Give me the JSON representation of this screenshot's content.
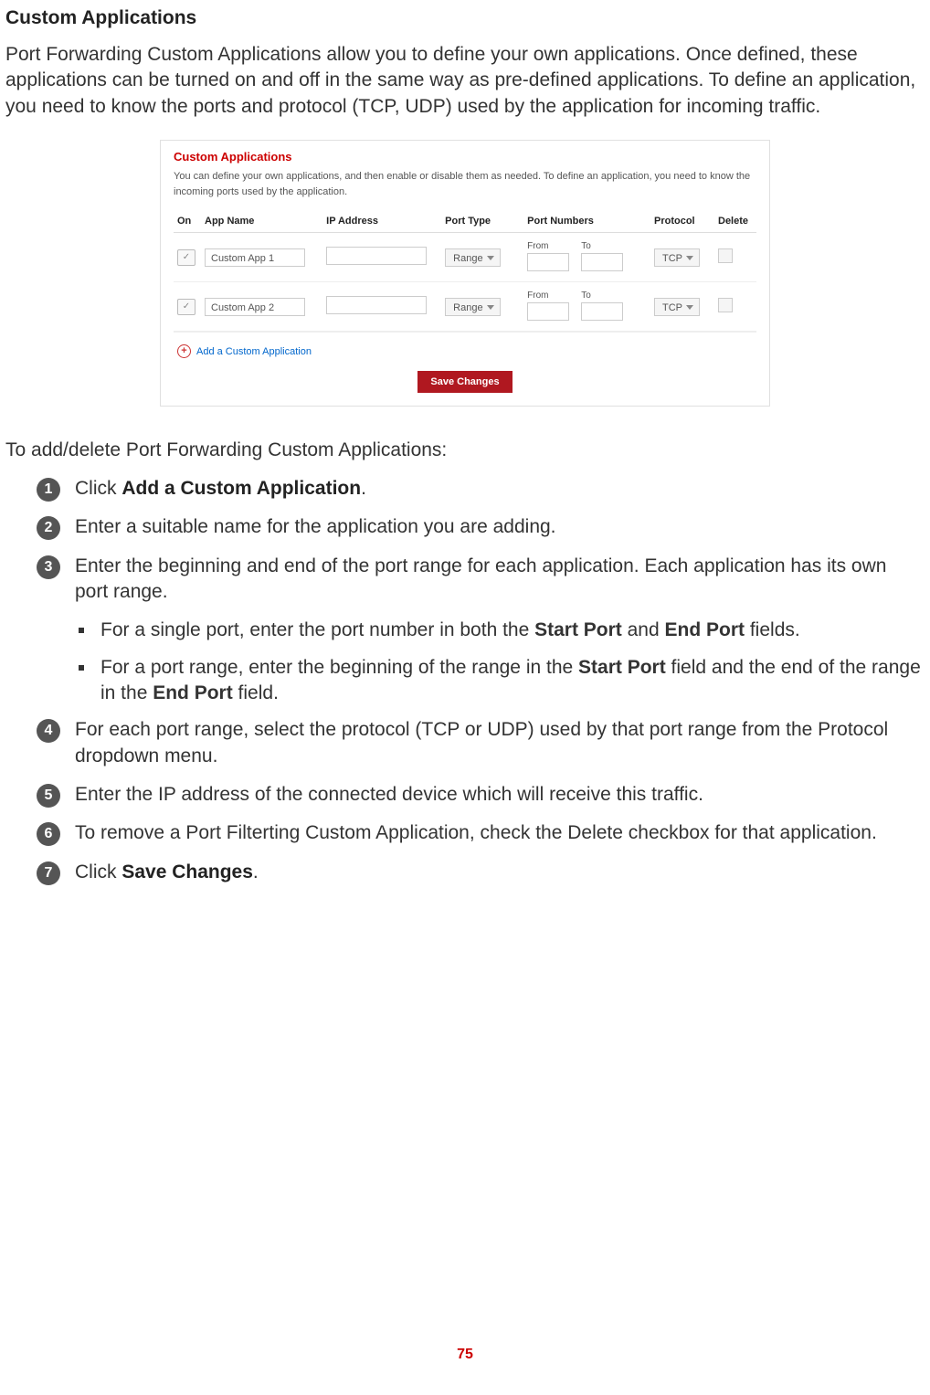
{
  "title": "Custom Applications",
  "intro": "Port Forwarding Custom Applications allow you to define your own applications. Once defined, these applications can be turned on and off in the same way as pre-defined applications. To define an application, you need to know the ports and protocol (TCP, UDP) used by the application for incoming traffic.",
  "panel": {
    "title": "Custom Applications",
    "desc": "You can define your own applications, and then enable or disable them as needed. To define an application, you need to know the incoming ports used by the application.",
    "headers": {
      "on": "On",
      "app": "App Name",
      "ip": "IP Address",
      "ptype": "Port Type",
      "pnums": "Port Numbers",
      "proto": "Protocol",
      "del": "Delete"
    },
    "rows": [
      {
        "on": true,
        "app": "Custom App 1",
        "ip": "",
        "ptype": "Range",
        "from_label": "From",
        "to_label": "To",
        "from": "",
        "to": "",
        "proto": "TCP"
      },
      {
        "on": true,
        "app": "Custom App 2",
        "ip": "",
        "ptype": "Range",
        "from_label": "From",
        "to_label": "To",
        "from": "",
        "to": "",
        "proto": "TCP"
      }
    ],
    "add_label": "Add a Custom Application",
    "save_label": "Save Changes"
  },
  "lead_in": "To add/delete Port Forwarding Custom Applications:",
  "steps": {
    "s1a": "Click ",
    "s1b": "Add a Custom Application",
    "s1c": ".",
    "s2": "Enter a suitable name for the application you are adding.",
    "s3": "Enter the beginning and end of the port range for each application. Each application has its own port range.",
    "b1a": "For a single port, enter the port number in both the ",
    "b1b": "Start Port",
    "b1c": " and ",
    "b1d": "End Port",
    "b1e": " fields.",
    "b2a": "For a port range, enter the beginning of the range in the ",
    "b2b": "Start Port",
    "b2c": " field and the end of the range in the ",
    "b2d": "End Port",
    "b2e": " field.",
    "s4": "For each port range, select the protocol (TCP or UDP) used by that port range from the Protocol dropdown menu.",
    "s5": "Enter the IP address of the connected device which will receive this traffic.",
    "s6": "To remove a Port Filterting Custom Application, check the Delete checkbox for that application.",
    "s7a": "Click ",
    "s7b": "Save Changes",
    "s7c": "."
  },
  "page_number": "75"
}
